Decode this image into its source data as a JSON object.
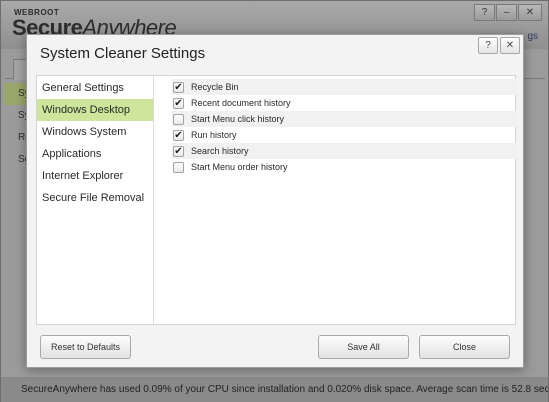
{
  "app": {
    "brand_small": "WEBROOT",
    "brand_bold": "Secure",
    "brand_italic": "Anywhere",
    "header_link": "gs",
    "minimize": "–",
    "close": "✕",
    "help": "?",
    "sidebar_stubs": [
      "Sy",
      "Sy",
      "Re",
      "Sc"
    ],
    "status_text": "SecureAnywhere has used 0.09% of your CPU since installation and 0.020% disk space. Average scan time is 52.8 seconds."
  },
  "dialog": {
    "title": "System Cleaner Settings",
    "help_glyph": "?",
    "close_glyph": "✕",
    "sidebar": [
      {
        "label": "General Settings",
        "active": false
      },
      {
        "label": "Windows Desktop",
        "active": true
      },
      {
        "label": "Windows System",
        "active": false
      },
      {
        "label": "Applications",
        "active": false
      },
      {
        "label": "Internet Explorer",
        "active": false
      },
      {
        "label": "Secure File Removal",
        "active": false
      }
    ],
    "options": [
      {
        "label": "Recycle Bin",
        "checked": true
      },
      {
        "label": "Recent document history",
        "checked": true
      },
      {
        "label": "Start Menu click history",
        "checked": false
      },
      {
        "label": "Run history",
        "checked": true
      },
      {
        "label": "Search history",
        "checked": true
      },
      {
        "label": "Start Menu order history",
        "checked": false
      }
    ],
    "buttons": {
      "reset": "Reset to Defaults",
      "save": "Save All",
      "close": "Close"
    }
  },
  "colors": {
    "active_item": "#cde69c",
    "dim_background": "#9b9b9b"
  },
  "icons": {
    "check": "checkmark-icon",
    "help": "question-icon",
    "close": "close-icon"
  }
}
